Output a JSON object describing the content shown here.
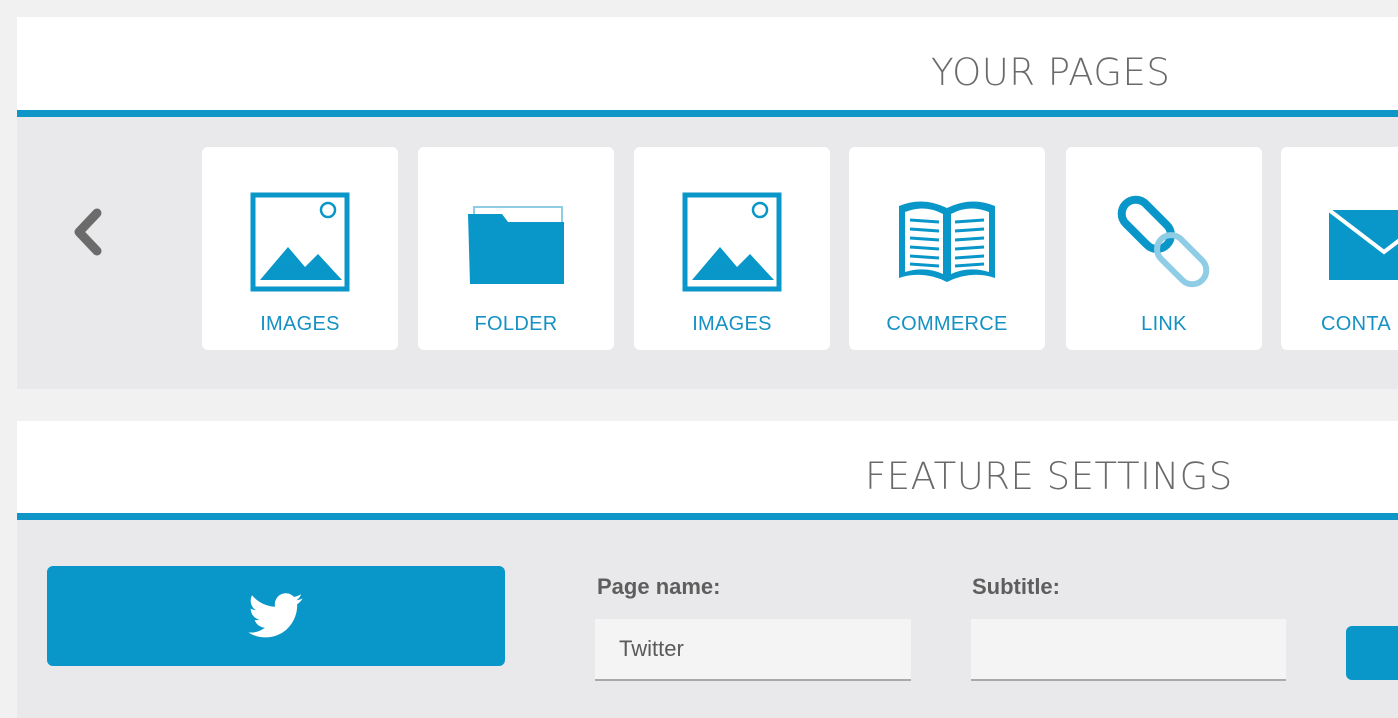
{
  "pages_section": {
    "title": "YOUR PAGES",
    "tiles": [
      {
        "label": "IMAGES",
        "icon": "image-icon"
      },
      {
        "label": "FOLDER",
        "icon": "folder-icon"
      },
      {
        "label": "IMAGES",
        "icon": "image-icon"
      },
      {
        "label": "COMMERCE",
        "icon": "book-icon"
      },
      {
        "label": "LINK",
        "icon": "link-icon"
      },
      {
        "label": "CONTA",
        "icon": "envelope-icon"
      }
    ],
    "prev_icon": "chevron-left-icon"
  },
  "feature_section": {
    "title": "FEATURE SETTINGS",
    "feature_icon": "twitter-icon",
    "page_name_label": "Page name:",
    "page_name_value": "Twitter",
    "subtitle_label": "Subtitle:",
    "subtitle_value": ""
  },
  "colors": {
    "accent": "#0e96c8",
    "label_text": "#1591c3",
    "panel_bg": "#e9e9eb"
  }
}
